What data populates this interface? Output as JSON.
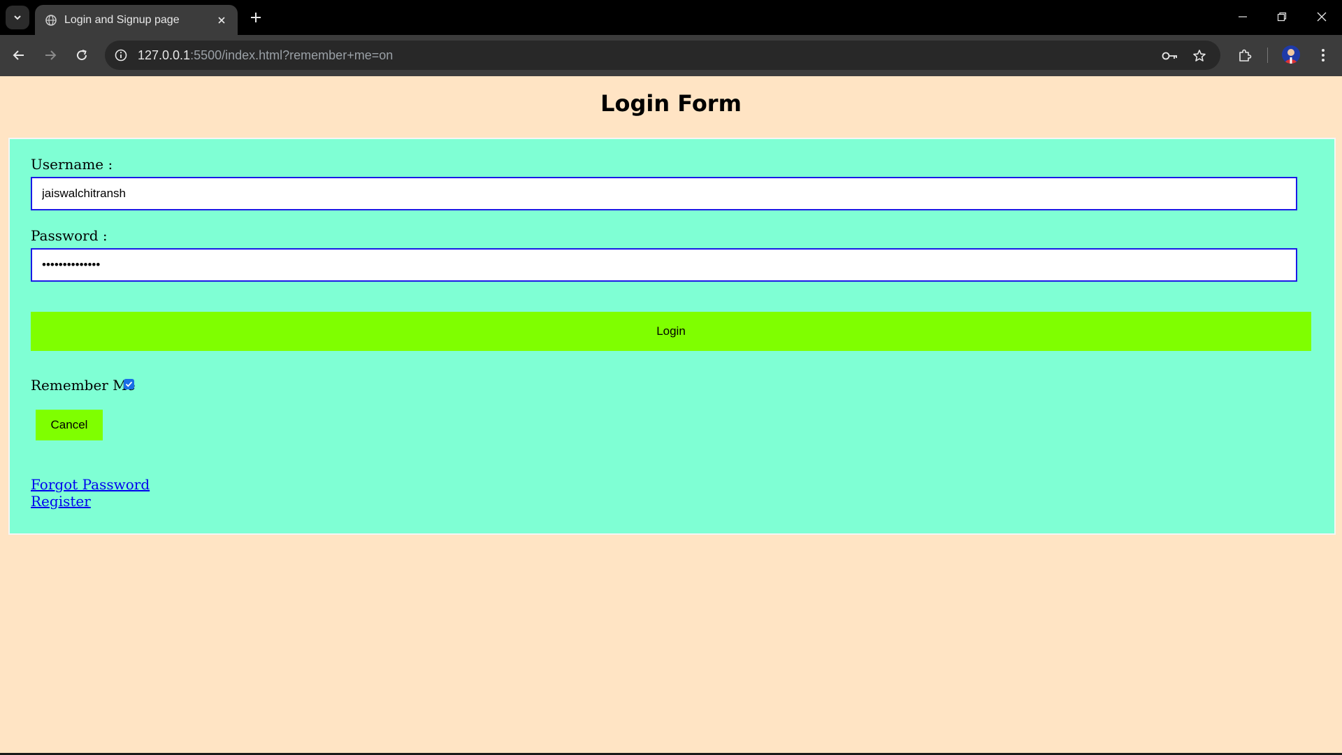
{
  "browser": {
    "tab_title": "Login and Signup page",
    "url_host": "127.0.0.1",
    "url_rest": ":5500/index.html?remember+me=on"
  },
  "page": {
    "heading": "Login Form",
    "username_label": "Username :",
    "username_value": "jaiswalchitransh",
    "password_label": "Password :",
    "password_value": "••••••••••••••",
    "login_label": "Login",
    "remember_label": "Remember Me",
    "remember_checked": true,
    "cancel_label": "Cancel",
    "forgot_link": "Forgot Password",
    "register_link": "Register"
  },
  "colors": {
    "page_bg": "#ffe4c4",
    "form_bg": "#7fffd4",
    "button_bg": "#7fff00",
    "input_border": "#1a1ae6",
    "link": "#0000ee"
  }
}
